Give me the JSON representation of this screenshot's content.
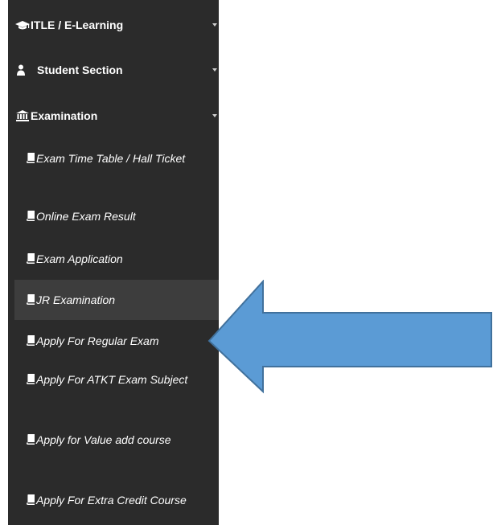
{
  "sidebar": {
    "top_items": [
      {
        "label": "ITLE / E-Learning",
        "icon": "graduation-cap-icon"
      },
      {
        "label": "Student Section",
        "icon": "user-icon"
      },
      {
        "label": "Examination",
        "icon": "institution-icon"
      }
    ],
    "sub_items": [
      {
        "label": "Exam Time Table / Hall Ticket",
        "icon": "book-icon"
      },
      {
        "label": "Online Exam Result",
        "icon": "book-icon"
      },
      {
        "label": "Exam Application",
        "icon": "book-icon"
      },
      {
        "label": "JR Examination",
        "icon": "book-icon",
        "active": true
      },
      {
        "label": "Apply For Regular Exam",
        "icon": "book-icon"
      },
      {
        "label": "Apply For ATKT Exam Subject",
        "icon": "book-icon"
      },
      {
        "label": "Apply for Value add course",
        "icon": "book-icon"
      },
      {
        "label": "Apply For Extra Credit Course",
        "icon": "book-icon"
      }
    ]
  },
  "colors": {
    "sidebar_bg": "#2b2b2b",
    "active_item_bg": "#3d3d3d",
    "text": "#ffffff",
    "arrow_fill": "#5b9bd5",
    "arrow_stroke": "#41719c"
  },
  "annotation": {
    "icon": "left-arrow-icon"
  }
}
